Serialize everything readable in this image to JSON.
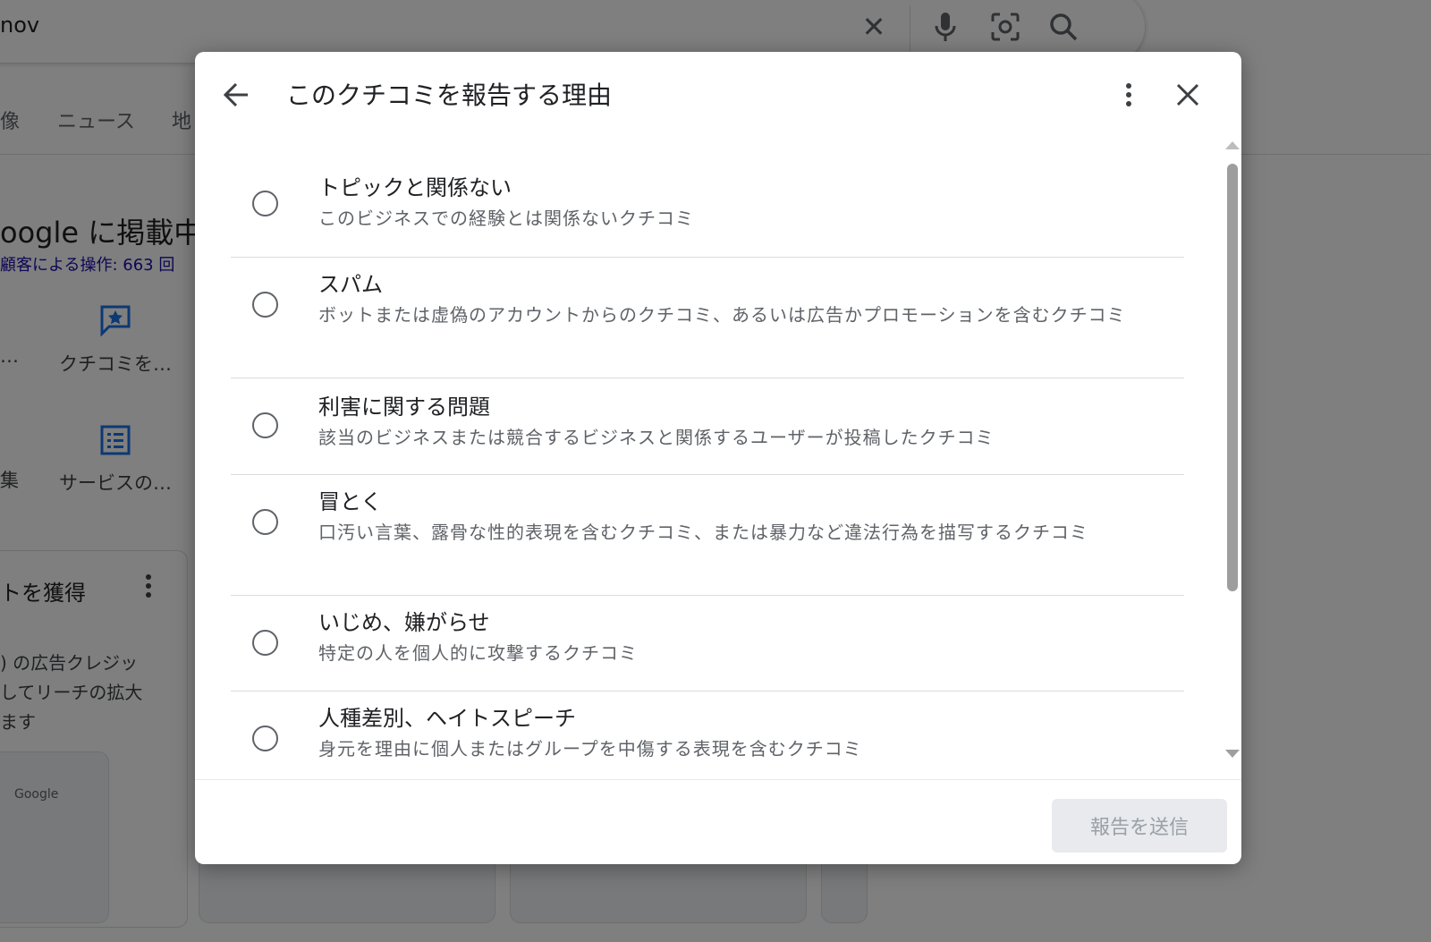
{
  "search": {
    "query": "nov"
  },
  "tabs": [
    "像",
    "ニュース",
    "地"
  ],
  "business": {
    "title": "oogle に掲載中",
    "subtitle": "顧客による操作: 663 回",
    "actions": [
      {
        "label": "…",
        "icon": "review-icon"
      },
      {
        "label": "クチコミを…",
        "icon": "review-icon"
      },
      {
        "label": "集",
        "icon": "list-icon"
      },
      {
        "label": "サービスの…",
        "icon": "list-icon"
      }
    ]
  },
  "card": {
    "title": "トを獲得",
    "body": [
      ") の広告クレジッ",
      "してリーチの拡大",
      "ます"
    ],
    "thumb_label": "Google"
  },
  "dialog": {
    "title": "このクチコミを報告する理由",
    "options": [
      {
        "title": "トピックと関係ない",
        "desc": "このビジネスでの経験とは関係ないクチコミ"
      },
      {
        "title": "スパム",
        "desc": "ボットまたは虚偽のアカウントからのクチコミ、あるいは広告かプロモーションを含むクチコミ"
      },
      {
        "title": "利害に関する問題",
        "desc": "該当のビジネスまたは競合するビジネスと関係するユーザーが投稿したクチコミ"
      },
      {
        "title": "冒とく",
        "desc": "口汚い言葉、露骨な性的表現を含むクチコミ、または暴力など違法行為を描写するクチコミ"
      },
      {
        "title": "いじめ、嫌がらせ",
        "desc": "特定の人を個人的に攻撃するクチコミ"
      },
      {
        "title": "人種差別、ヘイトスピーチ",
        "desc": "身元を理由に個人またはグループを中傷する表現を含むクチコミ"
      }
    ],
    "submit_label": "報告を送信"
  }
}
